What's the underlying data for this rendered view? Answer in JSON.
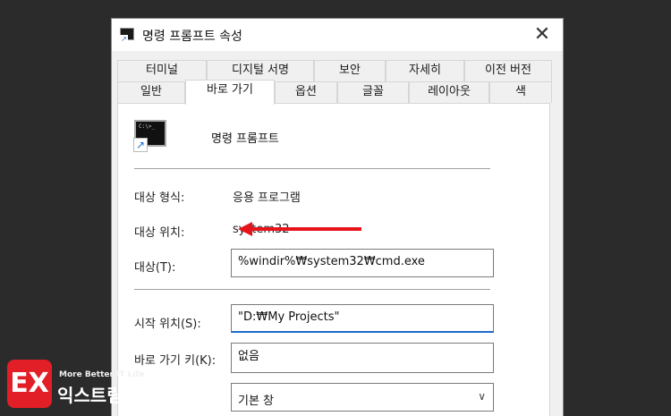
{
  "window": {
    "title": "명령 프롬프트 속성",
    "close_glyph": "✕"
  },
  "tabs": {
    "row1": [
      "터미널",
      "디지털 서명",
      "보안",
      "자세히",
      "이전 버전"
    ],
    "row2": [
      "일반",
      "바로 가기",
      "옵션",
      "글꼴",
      "레이아웃",
      "색"
    ],
    "active": "바로 가기"
  },
  "shortcut": {
    "app_name": "명령 프롬프트",
    "icon_prompt": "C:\\>_",
    "target_type_label": "대상 형식:",
    "target_type_value": "응용 프로그램",
    "target_location_label": "대상 위치:",
    "target_location_value": "system32",
    "target_label": "대상(T):",
    "target_value": "%windir%₩system32₩cmd.exe",
    "start_in_label": "시작 위치(S):",
    "start_in_value": "\"D:₩My Projects\"",
    "hotkey_label": "바로 가기 키(K):",
    "hotkey_value": "없음",
    "run_value": "기본 창"
  },
  "icons": {
    "app": "cmd-icon",
    "shortcut_arrow": "↗",
    "dropdown": "∨"
  },
  "colors": {
    "annotation_arrow": "#e8141b",
    "focus_underline": "#1b6ac9",
    "badge": "#e21f26"
  },
  "watermark": {
    "logo": "EX",
    "tagline": "More Better IT Life",
    "name": "익스트림 매뉴얼"
  }
}
